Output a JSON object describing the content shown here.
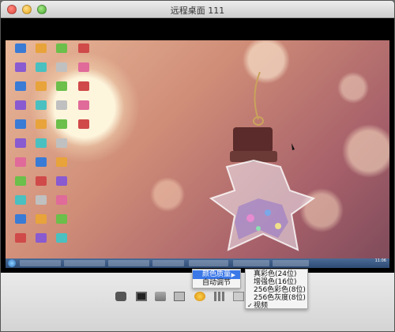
{
  "window": {
    "title": "远程桌面  111"
  },
  "menu_primary": {
    "items": [
      {
        "label": "颜色质量"
      },
      {
        "label": "自动调节"
      }
    ],
    "submenu_arrow": "▶"
  },
  "menu_color": {
    "items": [
      {
        "label": "真彩色(24位)"
      },
      {
        "label": "增强色(16位)"
      },
      {
        "label": "256色彩色(8位)"
      },
      {
        "label": "256色灰度(8位)"
      },
      {
        "label": "视频",
        "checked": true
      }
    ],
    "check_glyph": "✓"
  },
  "remote_desktop": {
    "clock": "11:06"
  },
  "colors": {
    "menu_highlight": "#3b78e7",
    "titlebar": "#dcdcdc",
    "toolbar": "#e0e0e0"
  },
  "toolbar_icons": [
    "screen-icon",
    "display-icon",
    "disk-icon",
    "keyboard-icon",
    "record-icon",
    "grid-icon",
    "doc-icon",
    "settings-icon"
  ]
}
